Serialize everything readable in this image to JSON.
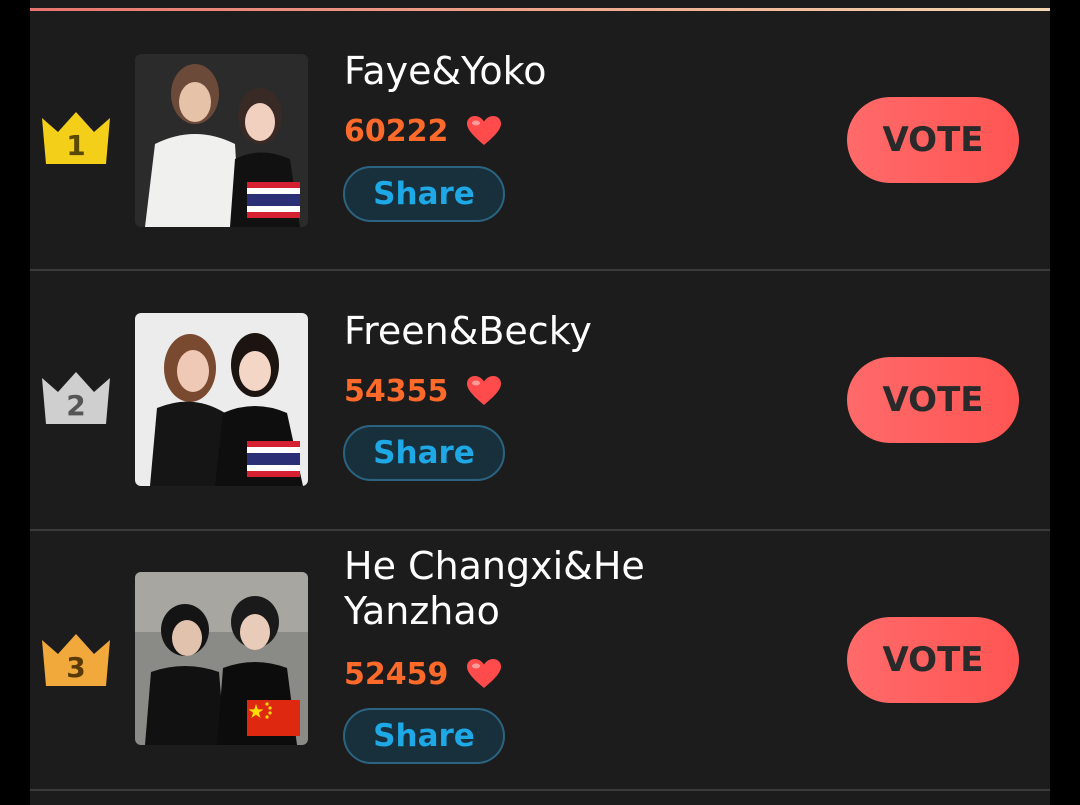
{
  "leaderboard": {
    "entries": [
      {
        "rank": "1",
        "name": "Faye&Yoko",
        "score": "60222",
        "share_label": "Share",
        "vote_label": "VOTE",
        "flag": "thailand-flag",
        "rank_color": "#f4cf1a"
      },
      {
        "rank": "2",
        "name": "Freen&Becky",
        "score": "54355",
        "share_label": "Share",
        "vote_label": "VOTE",
        "flag": "thailand-flag",
        "rank_color": "#cfcfcf"
      },
      {
        "rank": "3",
        "name": "He Changxi&He Yanzhao",
        "score": "52459",
        "share_label": "Share",
        "vote_label": "VOTE",
        "flag": "china-flag",
        "rank_color": "#f0a93a"
      }
    ]
  },
  "colors": {
    "score": "#ff6a2b",
    "share_text": "#1ea8e6",
    "vote_bg": "#ff5a5a",
    "panel_bg": "#1c1c1c"
  }
}
